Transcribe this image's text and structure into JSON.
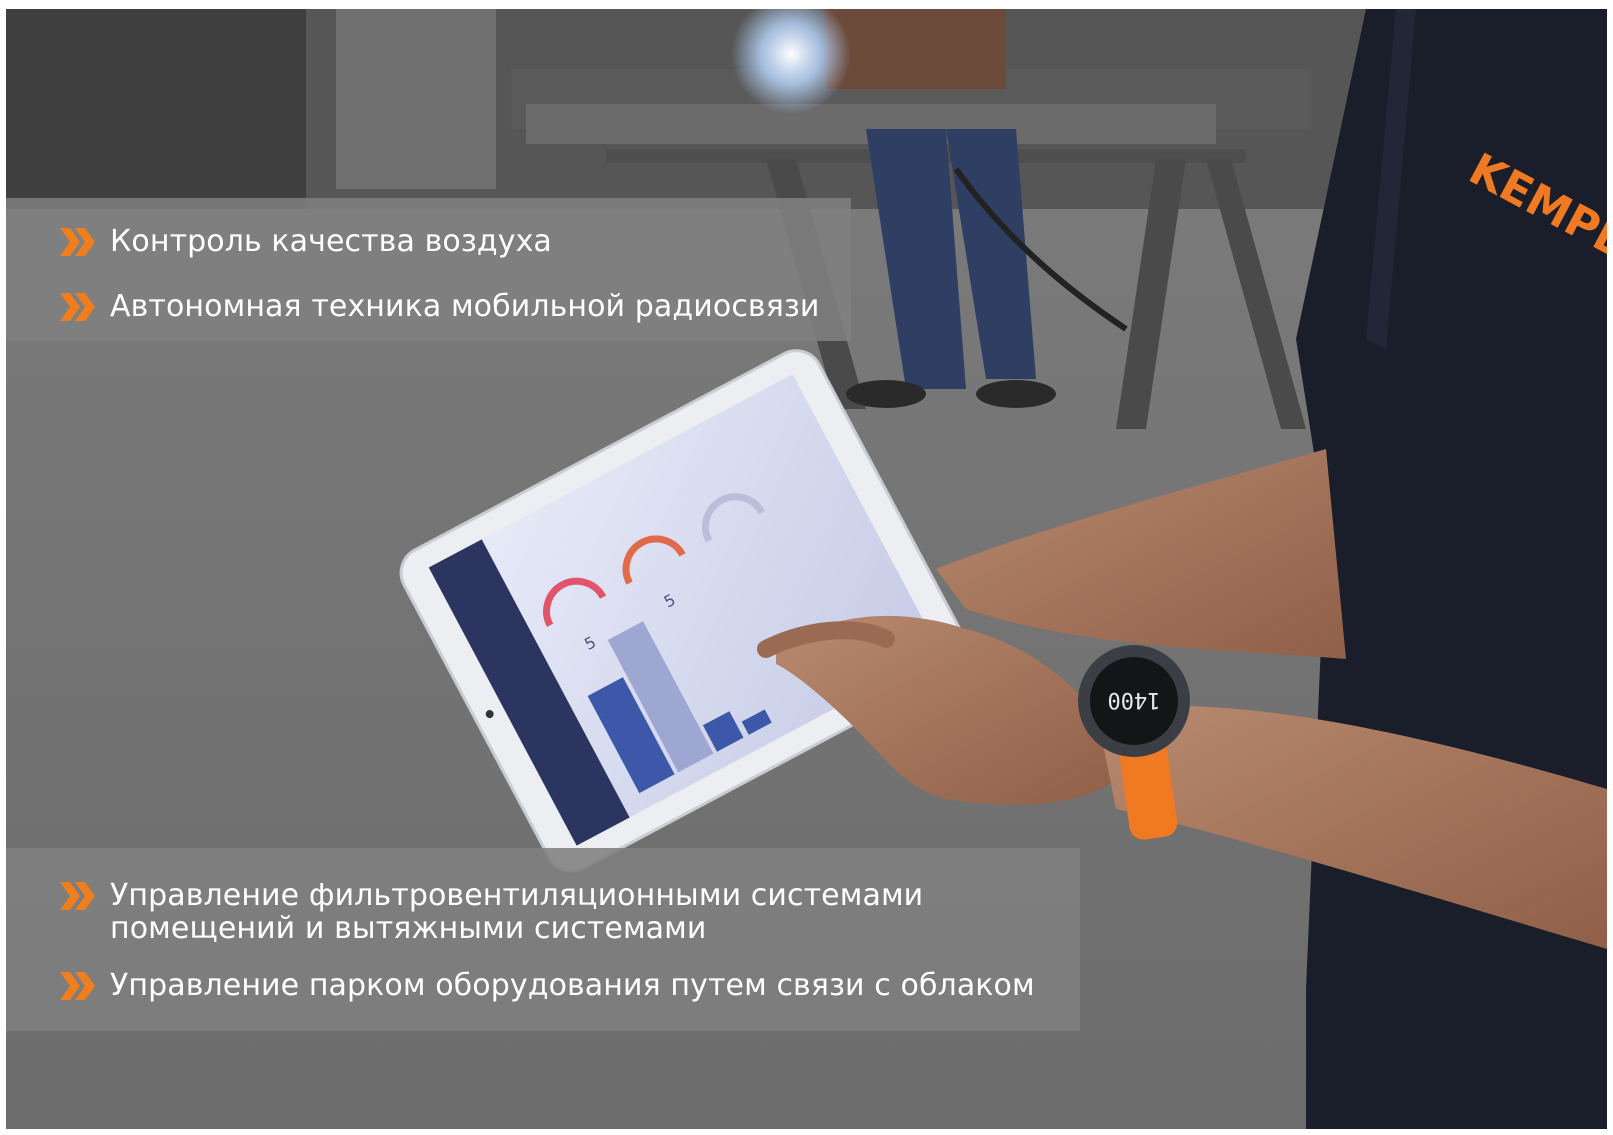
{
  "image": {
    "bullets": [
      {
        "text": "Контроль качества воздуха",
        "icon": "double-chevron-icon"
      },
      {
        "text": "Автономная техника мобильной радиосвязи",
        "icon": "double-chevron-icon"
      },
      {
        "text": "Управление фильтровентиляционными системами помещений и вытяжными системами",
        "icon": "double-chevron-icon"
      },
      {
        "text": "Управление парком оборудования путем связи с облаком",
        "icon": "double-chevron-icon"
      }
    ],
    "shirt_logo": "KEMPER",
    "watch_display": "1400",
    "tablet_gauges": [
      "5",
      "5"
    ],
    "colors": {
      "accent": "#f07d1e",
      "banner": "#808080",
      "shirt": "#1a1d2a",
      "tablet_sidebar": "#2b3560"
    }
  }
}
